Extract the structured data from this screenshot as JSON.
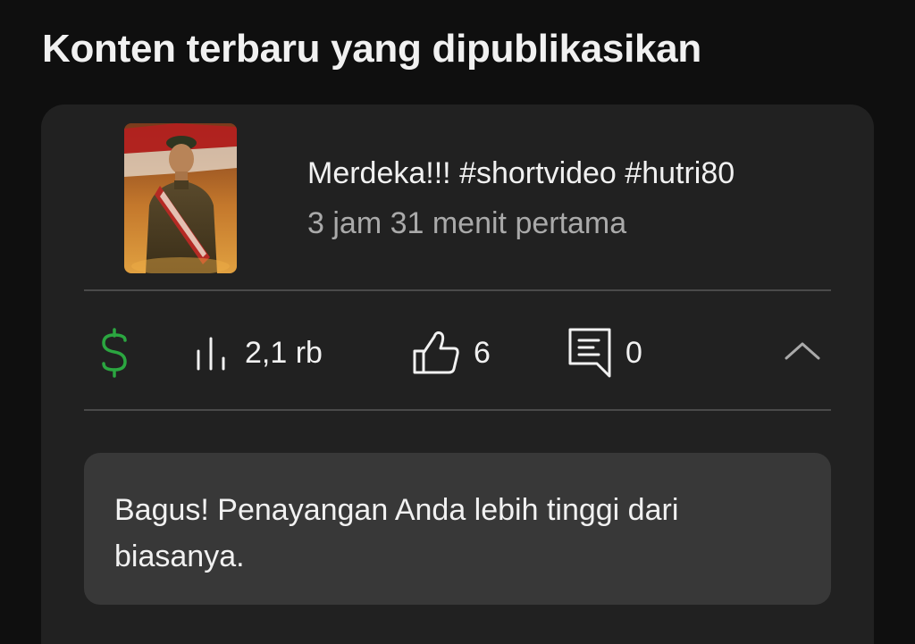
{
  "section": {
    "title": "Konten terbaru yang dipublikasikan"
  },
  "video": {
    "title": "Merdeka!!! #shortvideo #hutri80",
    "meta": "3 jam 31 menit pertama",
    "thumbnail_icon": "soldier-portrait-thumbnail"
  },
  "stats": {
    "monetization_icon": "dollar-icon",
    "views_icon": "bar-chart-icon",
    "views": "2,1 rb",
    "likes_icon": "thumbs-up-icon",
    "likes": "6",
    "comments_icon": "comment-icon",
    "comments": "0",
    "collapse_icon": "chevron-up-icon"
  },
  "insight": {
    "text": "Bagus! Penayangan Anda lebih tinggi dari biasanya."
  },
  "colors": {
    "background": "#0f0f0f",
    "card": "#212121",
    "insight_box": "#383838",
    "monetization_green": "#2ba640",
    "secondary_text": "#aaaaaa"
  }
}
